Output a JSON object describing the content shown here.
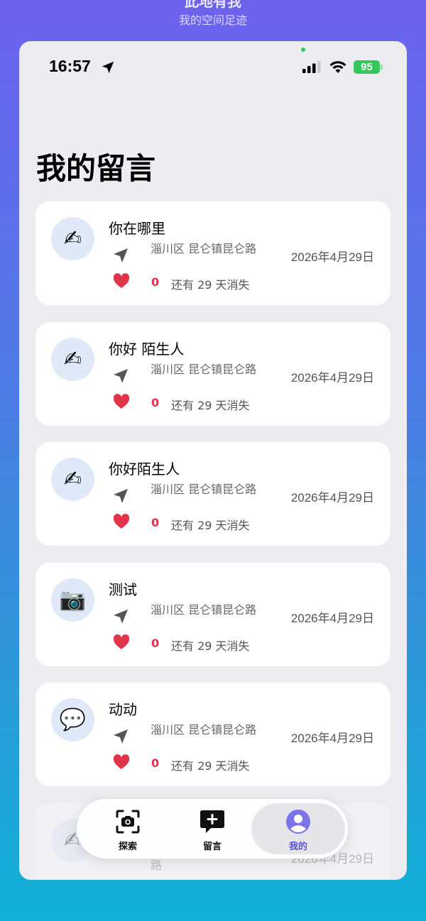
{
  "header": {
    "title": "此地有我",
    "subtitle": "我的空间足迹"
  },
  "status_bar": {
    "time": "16:57",
    "battery": "95"
  },
  "page": {
    "title": "我的留言"
  },
  "messages": [
    {
      "title": "你在哪里",
      "location": "淄川区 昆仑镇昆仑路",
      "date": "2026年4月29日",
      "likes": "0",
      "expire": "还有 29 天消失",
      "icon": "✍"
    },
    {
      "title": "你好 陌生人",
      "location": "淄川区 昆仑镇昆仑路",
      "date": "2026年4月29日",
      "likes": "0",
      "expire": "还有 29 天消失",
      "icon": "✍"
    },
    {
      "title": "你好陌生人",
      "location": "淄川区 昆仑镇昆仑路",
      "date": "2026年4月29日",
      "likes": "0",
      "expire": "还有 29 天消失",
      "icon": "✍"
    },
    {
      "title": "测试",
      "location": "淄川区 昆仑镇昆仑路",
      "date": "2026年4月29日",
      "likes": "0",
      "expire": "还有 29 天消失",
      "icon": "📷"
    },
    {
      "title": "动动",
      "location": "淄川区 昆仑镇昆仑路",
      "date": "2026年4月29日",
      "likes": "0",
      "expire": "还有 29 天消失",
      "icon": "💬"
    },
    {
      "title": "",
      "location": "路",
      "date": "2026年4月29日",
      "likes": "",
      "expire": "",
      "icon": "✍"
    }
  ],
  "tabbar": {
    "explore": "探索",
    "post": "留言",
    "mine": "我的"
  },
  "colors": {
    "accent": "#5b55d6",
    "heart": "#e0344b",
    "battery": "#34c759"
  }
}
